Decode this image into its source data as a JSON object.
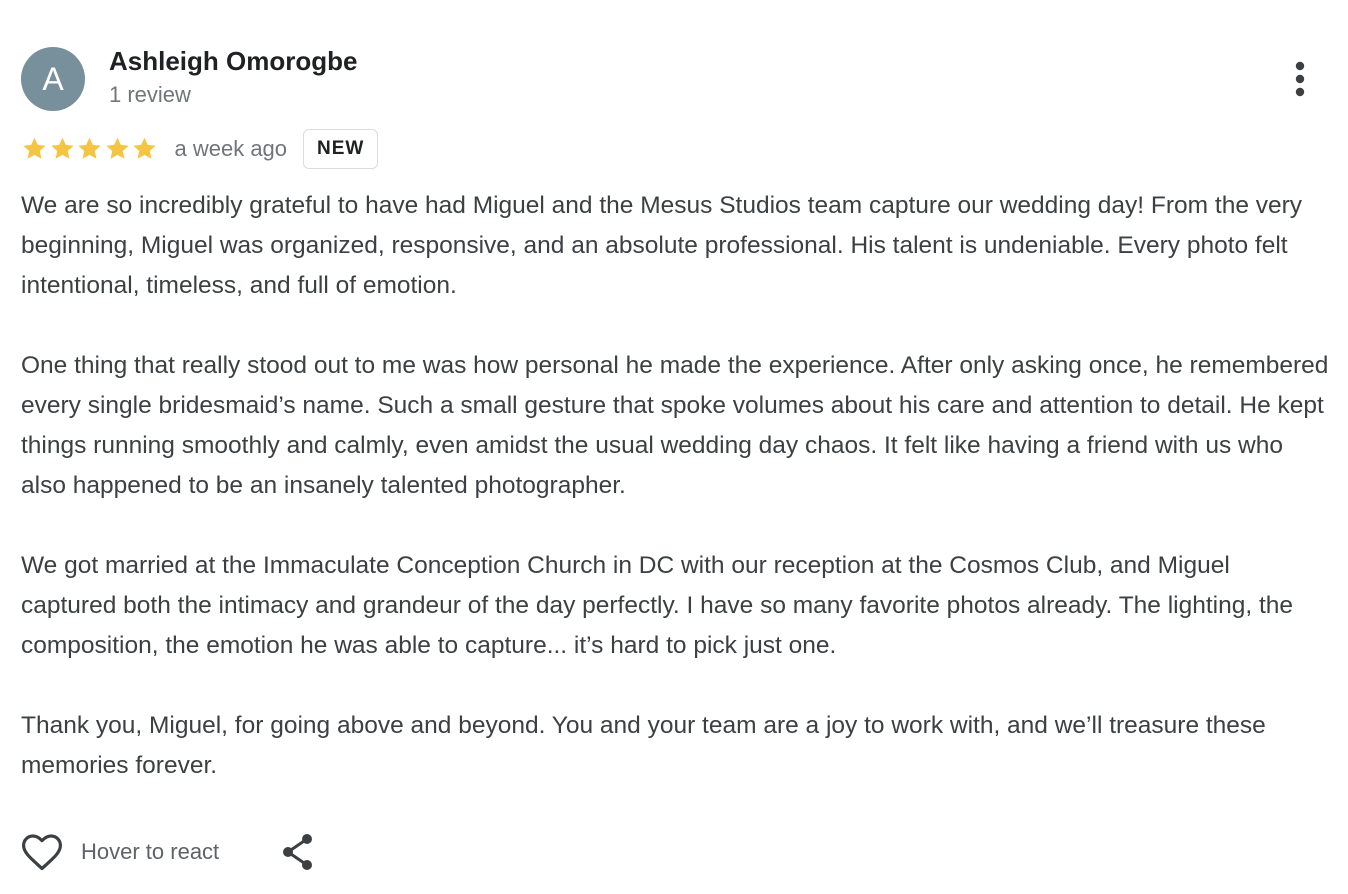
{
  "reviewer": {
    "avatar_letter": "A",
    "avatar_color": "#78909c",
    "name": "Ashleigh Omorogbe",
    "review_count": "1 review"
  },
  "rating": {
    "stars": 5,
    "max_stars": 5,
    "star_color": "#f4c542",
    "timestamp": "a week ago",
    "badge": "NEW"
  },
  "review": {
    "paragraphs": [
      "We are so incredibly grateful to have had Miguel and the Mesus Studios team capture our wedding day! From the very beginning, Miguel was organized, responsive, and an absolute professional. His talent is undeniable. Every photo felt intentional, timeless, and full of emotion.",
      "One thing that really stood out to me was how personal he made the experience. After only asking once, he remembered every single bridesmaid’s name. Such a small gesture that spoke volumes about his care and attention to detail. He kept things running smoothly and calmly, even amidst the usual wedding day chaos. It felt like having a friend with us who also happened to be an insanely talented photographer.",
      "We got married at the Immaculate Conception Church in DC with our reception at the Cosmos Club, and Miguel captured both the intimacy and grandeur of the day perfectly. I have so many favorite photos already. The lighting, the composition, the emotion he was able to capture... it’s hard to pick just one.",
      "Thank you, Miguel, for going above and beyond. You and your team are a joy to work with, and we’ll treasure these memories forever."
    ]
  },
  "actions": {
    "react_label": "Hover to react",
    "heart_icon": "heart-outline-icon",
    "share_icon": "share-icon",
    "more_icon": "more-vertical-icon"
  }
}
